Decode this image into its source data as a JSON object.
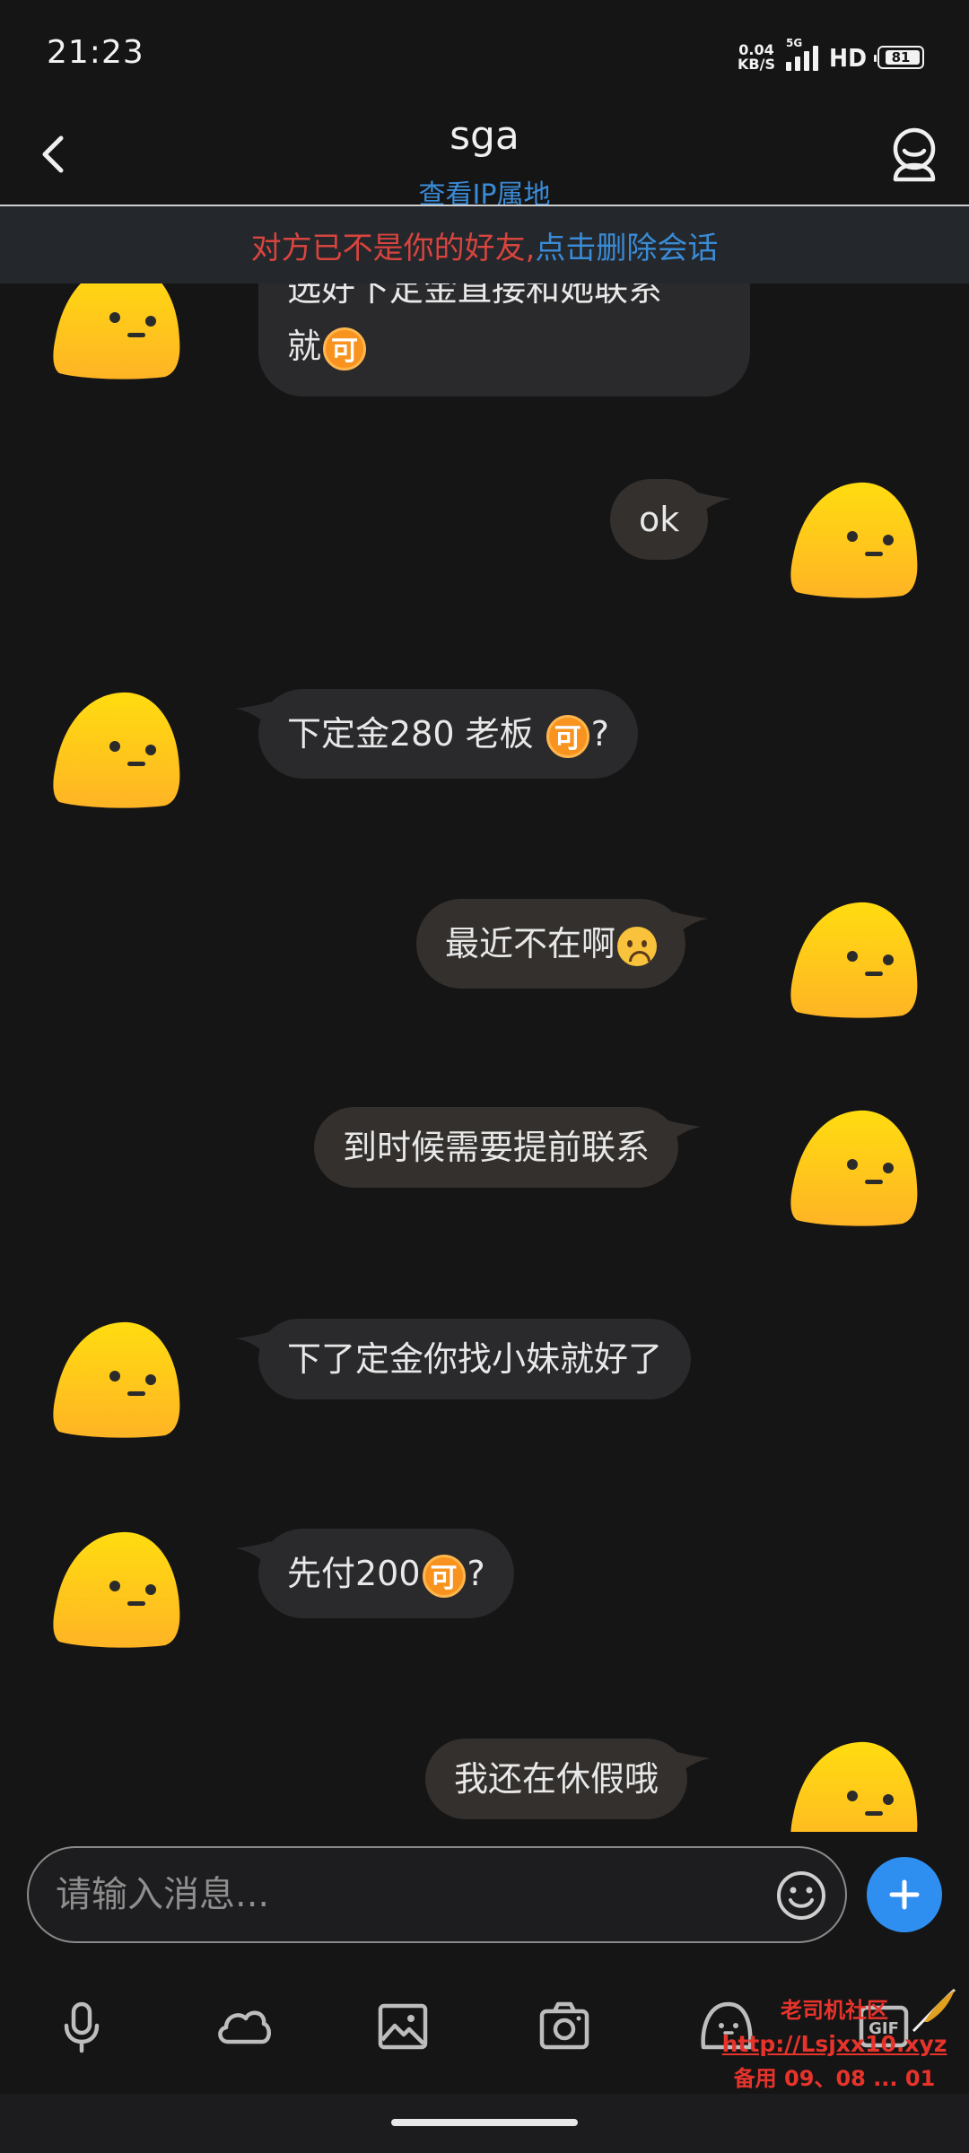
{
  "status_bar": {
    "time": "21:23",
    "net_speed_value": "0.04",
    "net_speed_unit": "KB/S",
    "network_type": "5G",
    "hd_label": "HD",
    "battery": "81"
  },
  "header": {
    "title": "sga",
    "subtitle": "查看IP属地",
    "back_icon": "chevron-left-icon",
    "profile_icon": "user-profile-icon"
  },
  "banner": {
    "warning_text": "对方已不是你的好友, ",
    "action_text": "点击删除会话"
  },
  "messages": [
    {
      "side": "theirs",
      "line1": "选好下定金直接和她联系",
      "line2_text": "就",
      "line2_emoji": "可"
    },
    {
      "side": "mine",
      "text": "ok"
    },
    {
      "side": "theirs",
      "text_before": "下定金280 老板 ",
      "emoji": "可",
      "text_after": "?"
    },
    {
      "side": "mine",
      "text": "最近不在啊",
      "emoji": "sad-face"
    },
    {
      "side": "mine",
      "text": "到时候需要提前联系"
    },
    {
      "side": "theirs",
      "text": "下了定金你找小妹就好了"
    },
    {
      "side": "theirs",
      "text_before": "先付200",
      "emoji": "可",
      "text_after": "?"
    },
    {
      "side": "mine",
      "text": "我还在休假哦"
    }
  ],
  "composer": {
    "placeholder": "请输入消息...",
    "emoji_icon": "smiley-icon",
    "plus_icon": "plus-icon"
  },
  "toolbar": {
    "icons": [
      "microphone-icon",
      "cloud-icon",
      "image-icon",
      "camera-icon",
      "ghost-icon",
      "gif-icon"
    ]
  },
  "watermark": {
    "line1": "老司机社区",
    "line2": "http://Lsjxx10.xyz",
    "line3": "备用 09、08 ... 01"
  },
  "colors": {
    "background": "#151516",
    "bubble_theirs": "#2a2a2c",
    "bubble_mine": "#33302d",
    "accent_blue": "#3a8bd6",
    "warning_red": "#d8443e",
    "plus_button": "#2f8ff0",
    "avatar_yellow": "#ffc21a"
  }
}
